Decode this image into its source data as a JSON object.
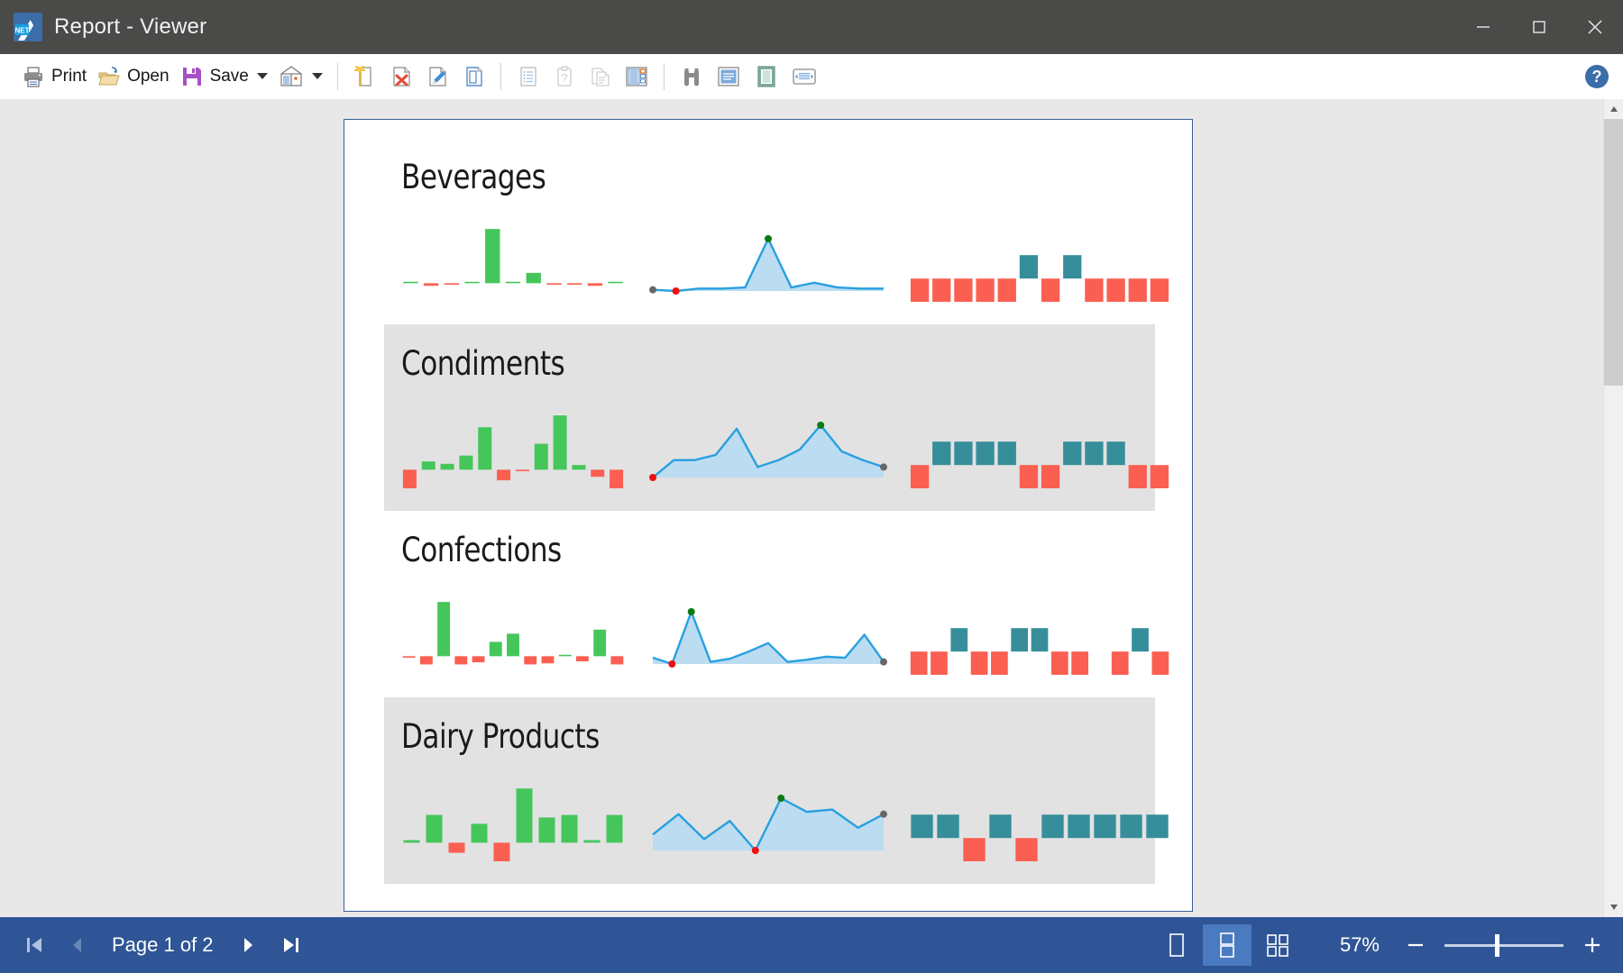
{
  "window": {
    "title": "Report - Viewer",
    "app_icon": "net-report-icon",
    "minimize_label": "Minimize",
    "maximize_label": "Maximize",
    "close_label": "Close"
  },
  "toolbar": {
    "print_label": "Print",
    "open_label": "Open",
    "save_label": "Save",
    "items": [
      {
        "name": "print-button",
        "icon": "printer-icon",
        "label": "Print"
      },
      {
        "name": "open-button",
        "icon": "folder-open-icon",
        "label": "Open"
      },
      {
        "name": "save-button",
        "icon": "floppy-disk-icon",
        "label": "Save"
      },
      {
        "name": "page-setup-button",
        "icon": "page-setup-icon",
        "label": ""
      },
      {
        "name": "new-report-button",
        "icon": "new-page-icon",
        "label": ""
      },
      {
        "name": "delete-page-button",
        "icon": "page-delete-icon",
        "label": ""
      },
      {
        "name": "edit-page-button",
        "icon": "page-edit-icon",
        "label": ""
      },
      {
        "name": "page-bookmarks-button",
        "icon": "page-frame-icon",
        "label": ""
      },
      {
        "name": "outline-button",
        "icon": "outline-icon",
        "label": ""
      },
      {
        "name": "page-properties-button",
        "icon": "clipboard-question-icon",
        "label": ""
      },
      {
        "name": "copy-page-button",
        "icon": "copy-page-icon",
        "label": ""
      },
      {
        "name": "thumbnails-button",
        "icon": "thumbnails-panel-icon",
        "label": ""
      },
      {
        "name": "find-button",
        "icon": "binoculars-icon",
        "label": ""
      },
      {
        "name": "page-width-button",
        "icon": "fit-width-icon",
        "label": ""
      },
      {
        "name": "whole-page-button",
        "icon": "whole-page-icon",
        "label": ""
      },
      {
        "name": "page-margins-button",
        "icon": "page-margins-icon",
        "label": ""
      }
    ],
    "help_label": "?"
  },
  "statusbar": {
    "first_page_label": "First page",
    "prev_page_label": "Previous page",
    "next_page_label": "Next page",
    "last_page_label": "Last page",
    "page_text": "Page 1 of 2",
    "current_page": 1,
    "total_pages": 2,
    "view_single_label": "Single page",
    "view_continuous_label": "Continuous",
    "view_multipage_label": "Multiple pages",
    "zoom_text": "57%",
    "zoom_value": 57,
    "zoom_out_label": "−",
    "zoom_in_label": "+"
  },
  "colors": {
    "titlebar": "#4a4a48",
    "statusbar": "#2f5596",
    "accent": "#4a7ac0",
    "page_border": "#3a5f94",
    "bar_positive": "#45c65a",
    "bar_negative": "#fb5f52",
    "line_stroke": "#28a0e0",
    "line_fill": "#bcdcf2",
    "marker_high": "#0b7a10",
    "marker_low": "#ee1111",
    "marker_end": "#666666",
    "win_box": "#378e9b",
    "loss_box": "#fb5f52",
    "row_shade": "#e2e2e2"
  },
  "chart_data": [
    {
      "type": "bar",
      "name": "Beverages",
      "title": "Beverages",
      "row_shaded": false,
      "series": [
        {
          "name": "change-sparkbar",
          "type": "bar",
          "values": [
            0,
            -2,
            -1,
            0,
            42,
            0,
            8,
            -1,
            -1,
            -2,
            0
          ]
        },
        {
          "name": "value-sparkline",
          "type": "area",
          "values": [
            3,
            2,
            4,
            4,
            5,
            46,
            5,
            9,
            5,
            4,
            4
          ],
          "marker_high_index": 5,
          "marker_low_index": 1,
          "marker_end_index": 0
        },
        {
          "name": "winloss-sparkbar",
          "type": "winloss",
          "values": [
            -1,
            -1,
            -1,
            -1,
            -1,
            1,
            -1,
            1,
            -1,
            -1,
            -1,
            -1
          ]
        }
      ]
    },
    {
      "type": "bar",
      "name": "Condiments",
      "title": "Condiments",
      "row_shaded": true,
      "series": [
        {
          "name": "change-sparkbar",
          "type": "bar",
          "values": [
            -26,
            7,
            5,
            12,
            36,
            -9,
            -1,
            22,
            46,
            4,
            -6,
            -16
          ]
        },
        {
          "name": "value-sparkline",
          "type": "area",
          "values": [
            2,
            22,
            22,
            28,
            58,
            14,
            22,
            34,
            62,
            32,
            22,
            14
          ],
          "marker_high_index": 8,
          "marker_low_index": 0,
          "marker_end_index": 11
        },
        {
          "name": "winloss-sparkbar",
          "type": "winloss",
          "values": [
            -1,
            1,
            1,
            1,
            1,
            -1,
            -1,
            1,
            1,
            1,
            -1,
            -1
          ]
        }
      ]
    },
    {
      "type": "bar",
      "name": "Confections",
      "title": "Confections",
      "row_shaded": false,
      "series": [
        {
          "name": "change-sparkbar",
          "type": "bar",
          "values": [
            -1,
            -8,
            53,
            -8,
            -6,
            14,
            22,
            -8,
            -7,
            1,
            -5,
            26,
            -8
          ]
        },
        {
          "name": "value-sparkline",
          "type": "area",
          "values": [
            10,
            4,
            54,
            6,
            9,
            16,
            24,
            6,
            8,
            11,
            10,
            32,
            6
          ],
          "marker_high_index": 2,
          "marker_low_index": 1,
          "marker_end_index": 12
        },
        {
          "name": "winloss-sparkbar",
          "type": "winloss",
          "values": [
            -1,
            -1,
            1,
            -1,
            -1,
            1,
            1,
            -1,
            -1,
            0,
            -1,
            1,
            -1
          ]
        }
      ]
    },
    {
      "type": "bar",
      "name": "Dairy Products",
      "title": "Dairy Products",
      "row_shaded": true,
      "series": [
        {
          "name": "change-sparkbar",
          "type": "bar",
          "values": [
            2,
            22,
            -8,
            15,
            -20,
            43,
            20,
            22,
            2,
            22
          ]
        },
        {
          "name": "value-sparkline",
          "type": "area",
          "values": [
            16,
            34,
            12,
            28,
            2,
            48,
            36,
            38,
            22,
            34
          ],
          "marker_high_index": 5,
          "marker_low_index": 4,
          "marker_end_index": 9
        },
        {
          "name": "winloss-sparkbar",
          "type": "winloss",
          "values": [
            1,
            1,
            -1,
            1,
            -1,
            1,
            1,
            1,
            1,
            1
          ]
        }
      ]
    }
  ]
}
